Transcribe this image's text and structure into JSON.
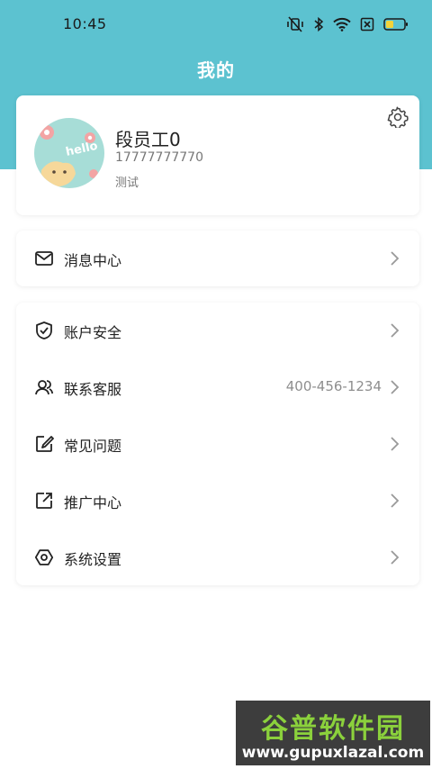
{
  "status_bar": {
    "time": "10:45",
    "icons": [
      "mute-vibrate-icon",
      "bluetooth-icon",
      "wifi-icon",
      "sim-off-icon",
      "battery-icon"
    ]
  },
  "header": {
    "title": "我的",
    "background_color": "#5cc2d0"
  },
  "profile": {
    "name": "段员工0",
    "phone": "17777777770",
    "tag": "测试",
    "avatar_text": "hello",
    "settings_icon": "gear-icon"
  },
  "message_center": {
    "label": "消息中心",
    "icon": "mail-icon"
  },
  "menu": {
    "items": [
      {
        "label": "账户安全",
        "icon": "shield-check-icon",
        "value": ""
      },
      {
        "label": "联系客服",
        "icon": "customer-service-icon",
        "value": "400-456-1234"
      },
      {
        "label": "常见问题",
        "icon": "edit-square-icon",
        "value": ""
      },
      {
        "label": "推广中心",
        "icon": "share-external-icon",
        "value": ""
      },
      {
        "label": "系统设置",
        "icon": "hexagon-settings-icon",
        "value": ""
      }
    ]
  },
  "watermark": {
    "brand": "谷普软件园",
    "url": "www.gupuxlazal.com"
  }
}
